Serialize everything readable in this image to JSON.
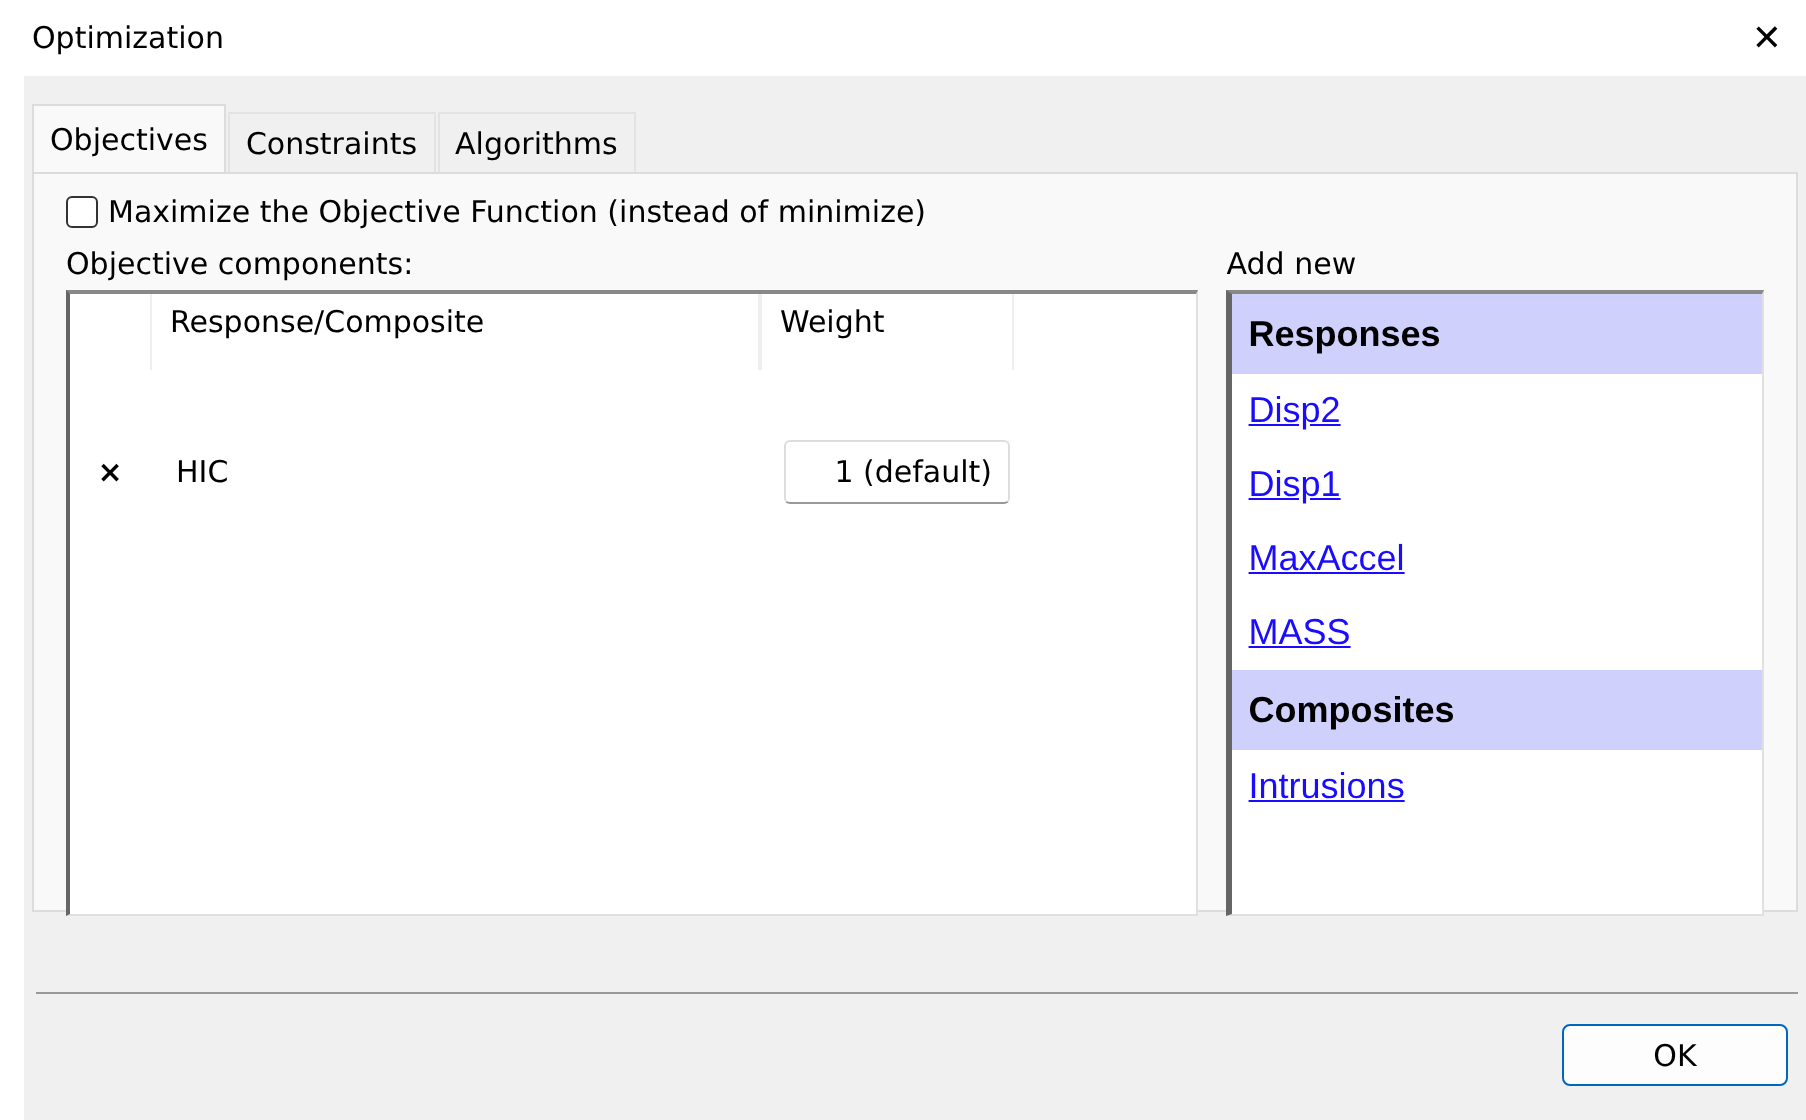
{
  "window": {
    "title": "Optimization",
    "close": "✕"
  },
  "tabs": [
    {
      "label": "Objectives",
      "selected": true
    },
    {
      "label": "Constraints",
      "selected": false
    },
    {
      "label": "Algorithms",
      "selected": false
    }
  ],
  "maximize": {
    "label": "Maximize the Objective Function (instead of minimize)",
    "checked": false
  },
  "components": {
    "label": "Objective components:",
    "columns": [
      "Response/Composite",
      "Weight"
    ],
    "rows": [
      {
        "remove": "×",
        "name": "HIC",
        "weight": "1 (default)"
      }
    ]
  },
  "add_new": {
    "label": "Add new",
    "items": [
      {
        "kind": "header",
        "text": "Responses"
      },
      {
        "kind": "link",
        "text": "Disp2"
      },
      {
        "kind": "link",
        "text": "Disp1"
      },
      {
        "kind": "link",
        "text": "MaxAccel"
      },
      {
        "kind": "link",
        "text": "MASS"
      },
      {
        "kind": "header",
        "text": "Composites"
      },
      {
        "kind": "link",
        "text": "Intrusions"
      }
    ]
  },
  "buttons": [
    "OK"
  ]
}
